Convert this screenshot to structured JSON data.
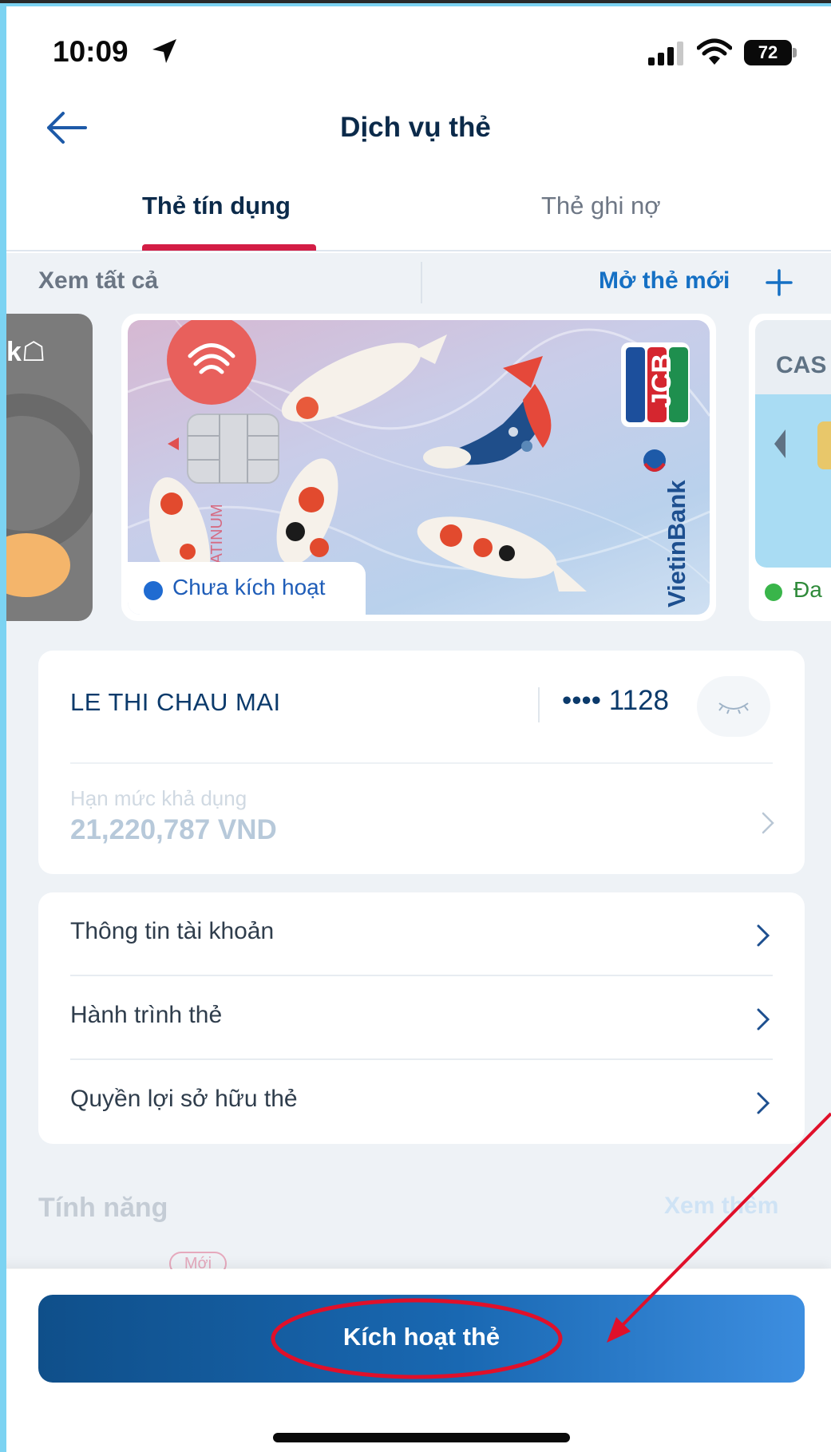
{
  "status_bar": {
    "time": "10:09",
    "battery": "72"
  },
  "header": {
    "title": "Dịch vụ thẻ"
  },
  "tabs": [
    {
      "label": "Thẻ tín dụng",
      "active": true
    },
    {
      "label": "Thẻ ghi nợ",
      "active": false
    }
  ],
  "card_actions": {
    "view_all": "Xem tất cả",
    "open_new": "Mở thẻ mới"
  },
  "cards": {
    "main_status": "Chưa kích hoạt",
    "right_card_text": "CAS",
    "right_card_status": "Đa"
  },
  "card_info": {
    "holder": "LE THI CHAU MAI",
    "masked_number": "•••• 1128",
    "limit_label": "Hạn mức khả dụng",
    "limit_value": "21,220,787 VND"
  },
  "menu": [
    {
      "label": "Thông tin tài khoản"
    },
    {
      "label": "Hành trình thẻ"
    },
    {
      "label": "Quyền lợi sở hữu thẻ"
    }
  ],
  "features": {
    "title": "Tính năng",
    "see_more": "Xem thêm",
    "new_badge": "Mới"
  },
  "bottom": {
    "activate_label": "Kích hoạt thẻ"
  },
  "colors": {
    "accent_tab": "#d31d45",
    "link": "#1570c4",
    "button": "#1968b2",
    "annotation": "#e0102a"
  }
}
